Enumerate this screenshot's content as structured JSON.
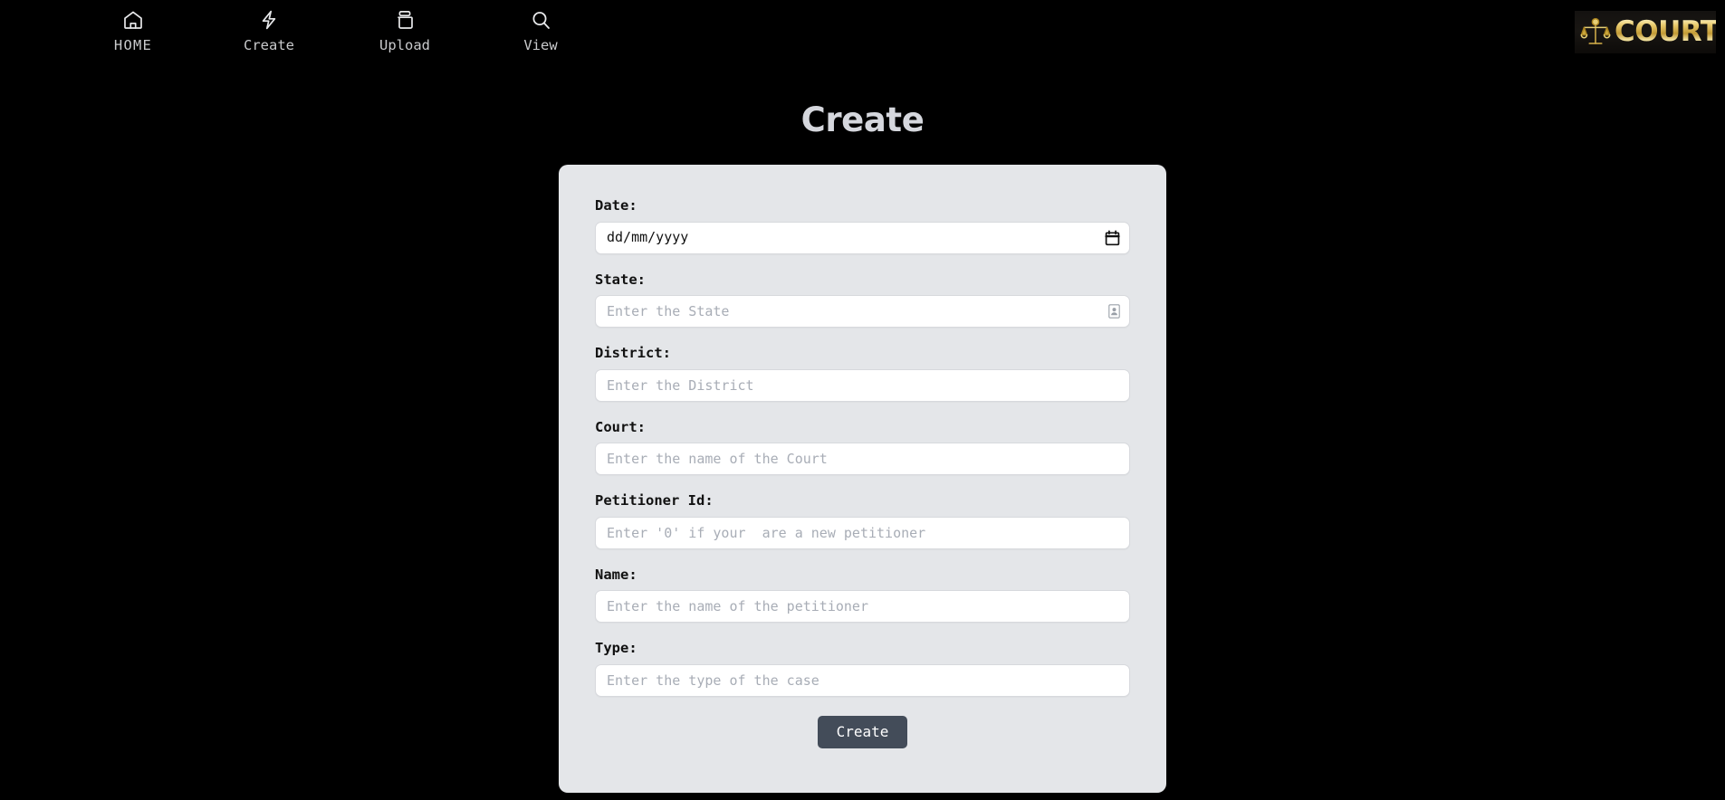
{
  "nav": {
    "items": [
      {
        "label": "HOME",
        "icon": "home-icon",
        "uppercase": true
      },
      {
        "label": "Create",
        "icon": "lightning-icon",
        "uppercase": false
      },
      {
        "label": "Upload",
        "icon": "archive-icon",
        "uppercase": false
      },
      {
        "label": "View",
        "icon": "search-icon",
        "uppercase": false
      }
    ]
  },
  "logo": {
    "text": "COURTIFY",
    "icon": "scales-of-justice-icon",
    "gold": "#e8c96a"
  },
  "page": {
    "title": "Create"
  },
  "form": {
    "fields": [
      {
        "label": "Date:",
        "value": "dd/mm/yyyy",
        "placeholder": "",
        "icon": "calendar-icon",
        "type": "date"
      },
      {
        "label": "State:",
        "value": "",
        "placeholder": "Enter the State",
        "icon": "contact-card-icon",
        "type": "text"
      },
      {
        "label": "District:",
        "value": "",
        "placeholder": "Enter the District",
        "icon": "",
        "type": "text"
      },
      {
        "label": "Court:",
        "value": "",
        "placeholder": "Enter the name of the Court",
        "icon": "",
        "type": "text"
      },
      {
        "label": "Petitioner Id:",
        "value": "",
        "placeholder": "Enter '0' if your  are a new petitioner",
        "icon": "",
        "type": "text"
      },
      {
        "label": "Name:",
        "value": "",
        "placeholder": "Enter the name of the petitioner",
        "icon": "",
        "type": "text"
      },
      {
        "label": "Type:",
        "value": "",
        "placeholder": "Enter the type of the case",
        "icon": "",
        "type": "text"
      }
    ],
    "submit_label": "Create"
  },
  "colors": {
    "background": "#000000",
    "card": "#e4e6e9",
    "button": "#434c59",
    "title": "#d5d7dd"
  }
}
